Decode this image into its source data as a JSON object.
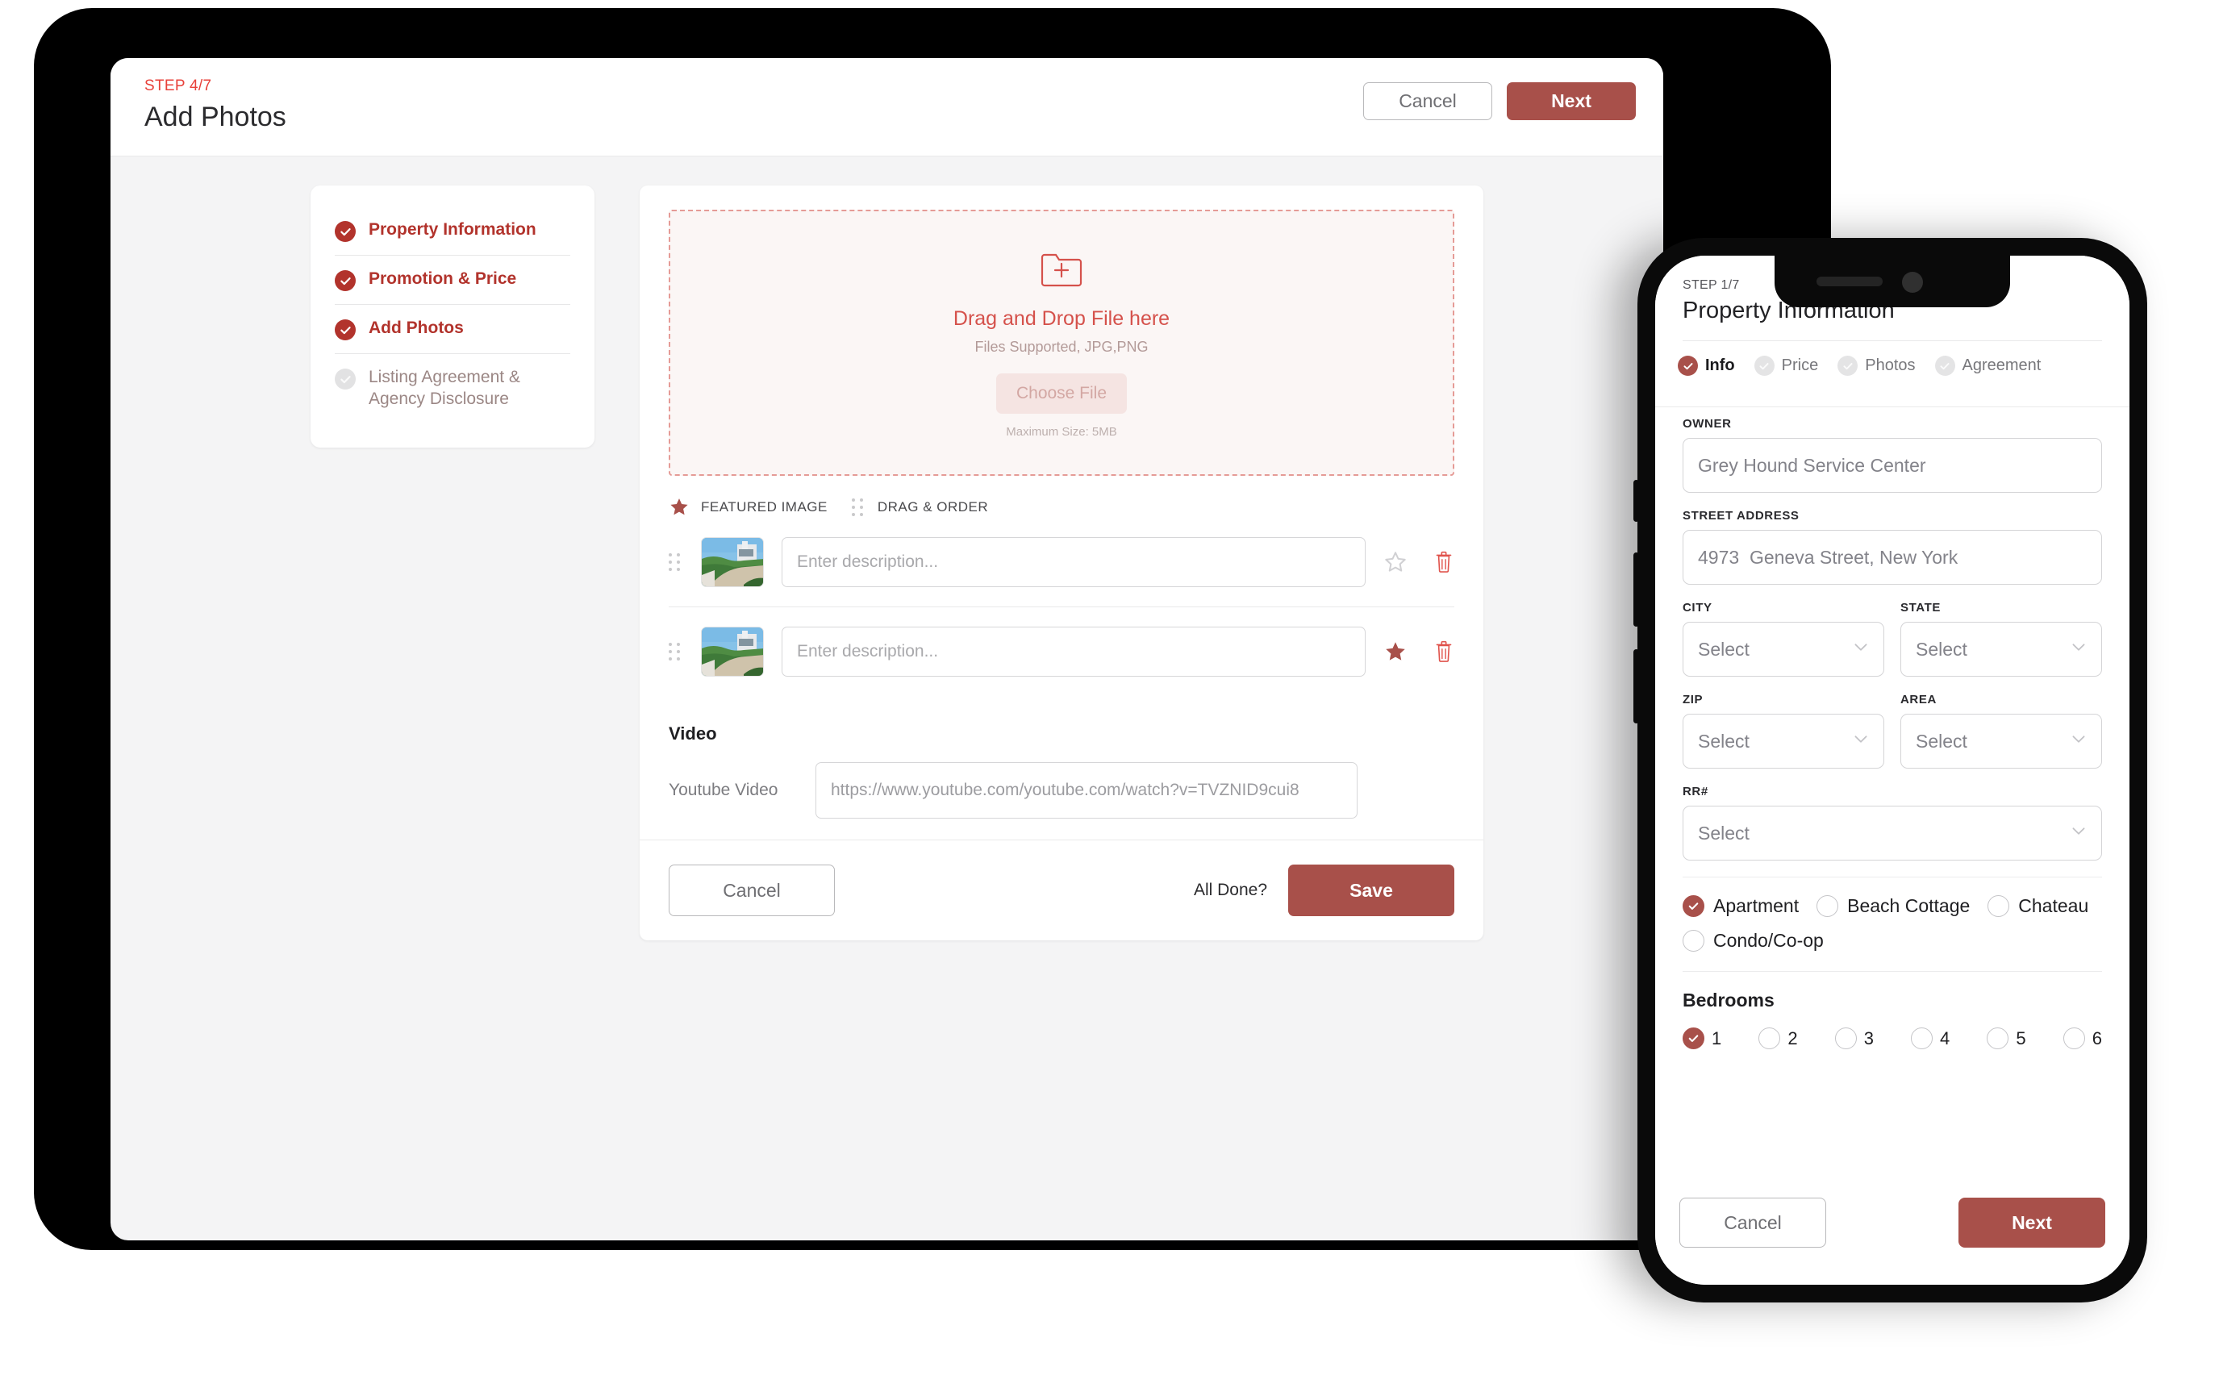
{
  "tablet": {
    "header": {
      "step": "STEP 4/7",
      "title": "Add Photos",
      "cancel_label": "Cancel",
      "next_label": "Next"
    },
    "steps": [
      {
        "label": "Property Information",
        "state": "done"
      },
      {
        "label": "Promotion & Price",
        "state": "done"
      },
      {
        "label": "Add Photos",
        "state": "done"
      },
      {
        "label": "Listing Agreement & Agency Disclosure",
        "state": "todo"
      }
    ],
    "dropzone": {
      "icon": "folder-plus-icon",
      "title": "Drag and Drop File here",
      "subtitle": "Files Supported, JPG,PNG",
      "choose_label": "Choose File",
      "max_size": "Maximum Size: 5MB"
    },
    "legend": {
      "featured_label": "FEATURED IMAGE",
      "drag_label": "DRAG & ORDER"
    },
    "photos": [
      {
        "description_placeholder": "Enter description...",
        "featured": false
      },
      {
        "description_placeholder": "Enter description...",
        "featured": true
      }
    ],
    "video": {
      "title": "Video",
      "label": "Youtube Video",
      "placeholder": "https://www.youtube.com/youtube.com/watch?v=TVZNID9cui8"
    },
    "footer": {
      "cancel_label": "Cancel",
      "all_done_label": "All Done?",
      "save_label": "Save"
    }
  },
  "phone": {
    "header": {
      "step": "STEP 1/7",
      "title": "Property Information"
    },
    "tabs": [
      {
        "label": "Info",
        "state": "on"
      },
      {
        "label": "Price",
        "state": "off"
      },
      {
        "label": "Photos",
        "state": "off"
      },
      {
        "label": "Agreement",
        "state": "off"
      }
    ],
    "fields": {
      "owner_label": "OWNER",
      "owner_value": "Grey Hound Service Center",
      "street_label": "STREET ADDRESS",
      "street_value": "4973  Geneva Street, New York",
      "city_label": "CITY",
      "city_value": "Select",
      "state_label": "STATE",
      "state_value": "Select",
      "zip_label": "ZIP",
      "zip_value": "Select",
      "area_label": "AREA",
      "area_value": "Select",
      "rr_label": "RR#",
      "rr_value": "Select"
    },
    "property_types": [
      {
        "label": "Apartment",
        "selected": true
      },
      {
        "label": "Beach Cottage",
        "selected": false
      },
      {
        "label": "Chateau",
        "selected": false
      },
      {
        "label": "Condo/Co-op",
        "selected": false
      }
    ],
    "bedrooms": {
      "title": "Bedrooms",
      "options": [
        {
          "label": "1",
          "selected": true
        },
        {
          "label": "2",
          "selected": false
        },
        {
          "label": "3",
          "selected": false
        },
        {
          "label": "4",
          "selected": false
        },
        {
          "label": "5",
          "selected": false
        },
        {
          "label": "6",
          "selected": false
        }
      ]
    },
    "footer": {
      "cancel_label": "Cancel",
      "next_label": "Next"
    }
  },
  "colors": {
    "accent": "#a8504a",
    "accent_dark": "#b2332c",
    "step_red": "#e8413a",
    "dropzone_border": "#e59b96"
  }
}
